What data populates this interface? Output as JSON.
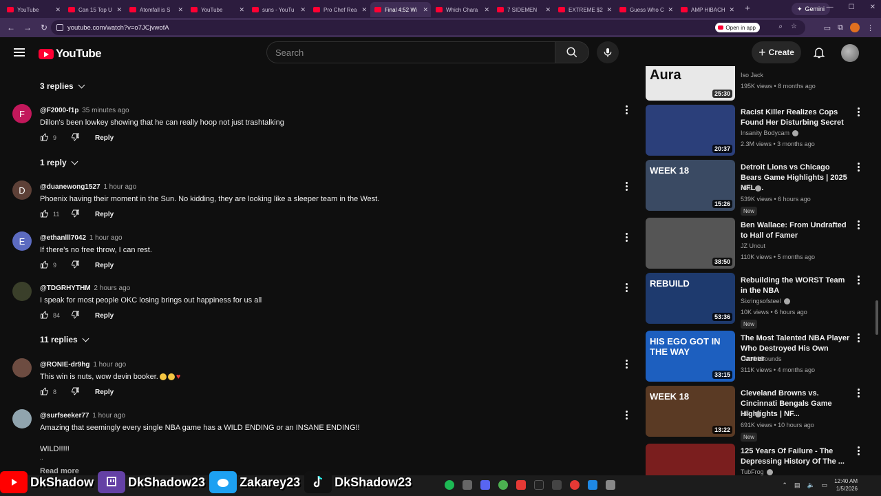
{
  "browser": {
    "tabs": [
      {
        "title": "YouTube"
      },
      {
        "title": "Can 15 Top U"
      },
      {
        "title": "Atomfall is S"
      },
      {
        "title": "YouTube"
      },
      {
        "title": "suns - YouTu"
      },
      {
        "title": "Pro Chef Rea"
      },
      {
        "title": "Final 4:52 Wi",
        "active": true
      },
      {
        "title": "Which Chara"
      },
      {
        "title": "7 SIDEMEN"
      },
      {
        "title": "EXTREME $2"
      },
      {
        "title": "Guess Who C"
      },
      {
        "title": "AMP HIBACH"
      }
    ],
    "gemini_label": "Gemini",
    "url": "youtube.com/watch?v=o7JCjvwofA",
    "open_in_app": "Open in app"
  },
  "header": {
    "logo_text": "YouTube",
    "search_placeholder": "Search",
    "create_label": "Create"
  },
  "comments": {
    "thread_toggles": [
      {
        "label": "3 replies"
      },
      {
        "label": "1 reply"
      },
      {
        "label": "11 replies"
      }
    ],
    "items": [
      {
        "user": "@F2000-f1p",
        "time": "35 minutes ago",
        "text": "Dillon's been lowkey showing that he can really hoop not just trashtalking",
        "likes": "9",
        "avatar_letter": "F",
        "avatar_color": "#c2185b"
      },
      {
        "user": "@duanewong1527",
        "time": "1 hour ago",
        "text": "Phoenix having their moment in the Sun. No kidding, they are looking like a sleeper team in the West.",
        "likes": "11",
        "avatar_letter": "D",
        "avatar_color": "#5d4037"
      },
      {
        "user": "@ethanlll7042",
        "time": "1 hour ago",
        "text": "If there's no free throw, I can rest.",
        "likes": "9",
        "avatar_letter": "E",
        "avatar_color": "#5c6bc0"
      },
      {
        "user": "@TDGRHYTHM",
        "time": "2 hours ago",
        "text": "I speak for most people OKC losing brings out happiness for us all",
        "likes": "84",
        "avatar_letter": "",
        "avatar_color": "#3a3f2a"
      },
      {
        "user": "@RONIE-dr9hg",
        "time": "1 hour ago",
        "text": "This win is nuts, wow devin booker.",
        "likes": "8",
        "avatar_letter": "",
        "avatar_color": "#6d4c41"
      },
      {
        "user": "@surfseeker77",
        "time": "1 hour ago",
        "text": "Amazing that seemingly every single NBA game has a WILD ENDING or an INSANE ENDING!!",
        "text2": "WILD!!!!!",
        "text3": "..",
        "likes": "",
        "avatar_letter": "",
        "avatar_color": "#90a4ae"
      }
    ],
    "reply_label": "Reply",
    "read_more": "Read more"
  },
  "sidebar": {
    "videos": [
      {
        "title": "",
        "thumb_text": "Aura",
        "channel": "Iso Jack",
        "verified": false,
        "meta": "195K views • 8 months ago",
        "duration": "25:30",
        "badge": "",
        "thumb_color": "#e8e8e8"
      },
      {
        "title": "Racist Killer Realizes Cops Found Her Disturbing Secret",
        "thumb_text": "",
        "channel": "Insanity Bodycam",
        "verified": true,
        "meta": "2.3M views • 3 months ago",
        "duration": "20:37",
        "badge": "",
        "thumb_color": "#2b3f7a"
      },
      {
        "title": "Detroit Lions vs Chicago Bears Game Highlights | 2025 NFL ...",
        "thumb_text": "WEEK 18",
        "channel": "NFL",
        "verified": true,
        "meta": "539K views • 6 hours ago",
        "duration": "15:26",
        "badge": "New",
        "thumb_color": "#3a4a63"
      },
      {
        "title": "Ben Wallace: From Undrafted to Hall of Famer",
        "thumb_text": "",
        "channel": "JZ Uncut",
        "verified": false,
        "meta": "110K views • 5 months ago",
        "duration": "38:50",
        "badge": "",
        "thumb_color": "#555555"
      },
      {
        "title": "Rebuilding the WORST Team in the NBA",
        "thumb_text": "REBUILD",
        "channel": "Sixringsofsteel",
        "verified": true,
        "meta": "10K views • 6 hours ago",
        "duration": "53:36",
        "badge": "New",
        "thumb_color": "#1e3a6e"
      },
      {
        "title": "The Most Talented NBA Player Who Destroyed His Own Career",
        "thumb_text": "HIS EGO GOT IN THE WAY",
        "channel": "Out Of Bounds",
        "verified": false,
        "meta": "311K views • 4 months ago",
        "duration": "33:15",
        "badge": "",
        "thumb_color": "#1d5fbf"
      },
      {
        "title": "Cleveland Browns vs. Cincinnati Bengals Game Highlights | NF...",
        "thumb_text": "WEEK 18",
        "channel": "NFL",
        "verified": true,
        "meta": "691K views • 10 hours ago",
        "duration": "13:22",
        "badge": "New",
        "thumb_color": "#5a3a24"
      },
      {
        "title": "125 Years Of Failure - The Depressing History Of The ...",
        "thumb_text": "",
        "channel": "TubFrog",
        "verified": true,
        "meta": "",
        "duration": "",
        "badge": "",
        "thumb_color": "#7a1e1e"
      }
    ]
  },
  "overlay": [
    {
      "platform": "youtube",
      "handle": "DkShadow",
      "color": "#ff0000"
    },
    {
      "platform": "twitch",
      "handle": "DkShadow23",
      "color": "#6441a5"
    },
    {
      "platform": "twitter",
      "handle": "Zakarey23",
      "color": "#1da1f2"
    },
    {
      "platform": "tiktok",
      "handle": "DkShadow23",
      "color": "#111111"
    }
  ],
  "taskbar": {
    "time": "12:40 AM",
    "date": "1/5/2026"
  }
}
